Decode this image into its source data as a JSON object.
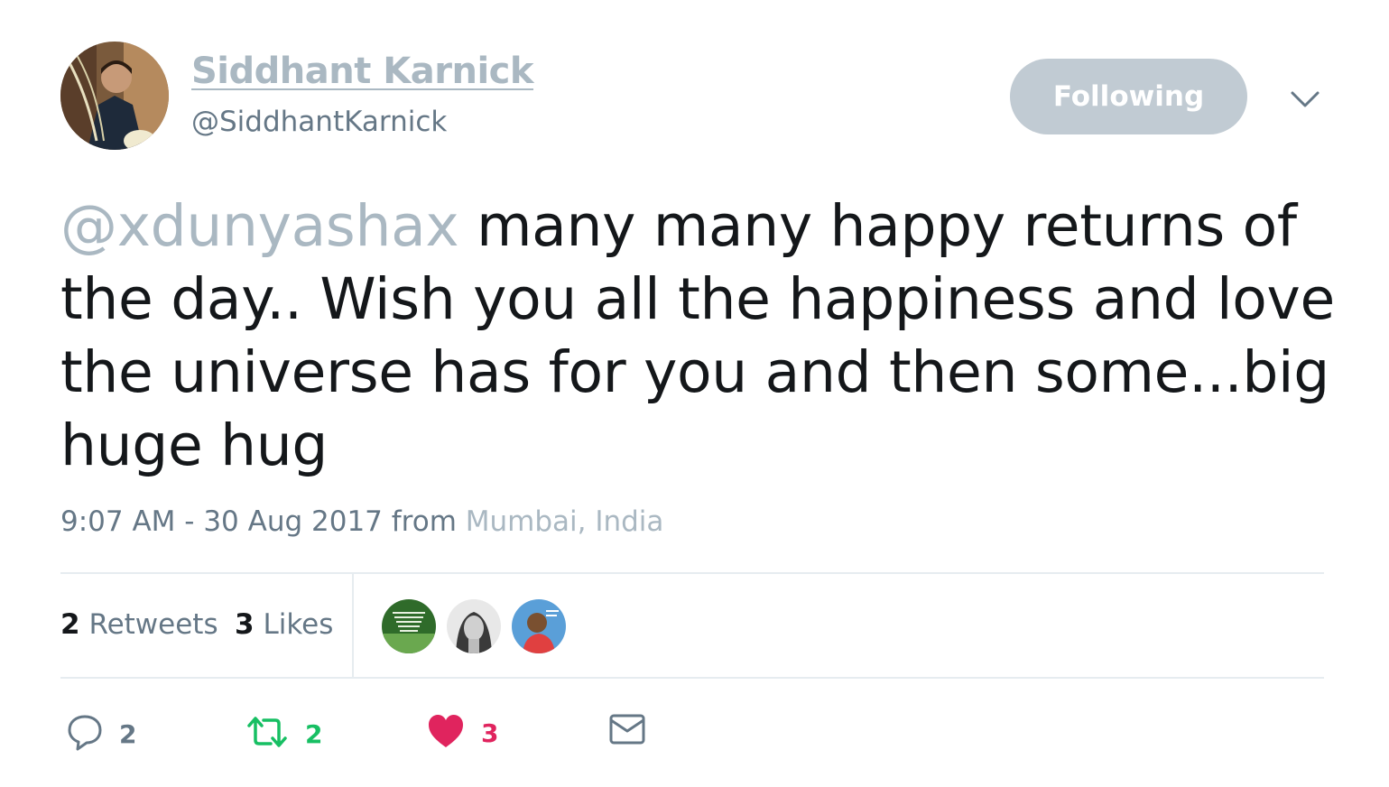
{
  "user": {
    "display_name": "Siddhant Karnick",
    "handle": "@SiddhantKarnick",
    "follow_label": "Following"
  },
  "tweet": {
    "mention": "@xdunyashax",
    "text": " many many happy returns of the day.. Wish you all the happiness and love the universe has for you and then some...big huge hug",
    "timestamp": "9:07 AM - 30 Aug 2017 from ",
    "location": "Mumbai, India"
  },
  "stats": {
    "retweets_count": "2",
    "retweets_label": "Retweets",
    "likes_count": "3",
    "likes_label": "Likes"
  },
  "actions": {
    "reply_count": "2",
    "retweet_count": "2",
    "like_count": "3"
  },
  "colors": {
    "muted": "#aab8c2",
    "follow_bg": "#c1cbd3",
    "retweet_green": "#17bf63",
    "like_red": "#e0245e",
    "icon_grey": "#657786"
  }
}
